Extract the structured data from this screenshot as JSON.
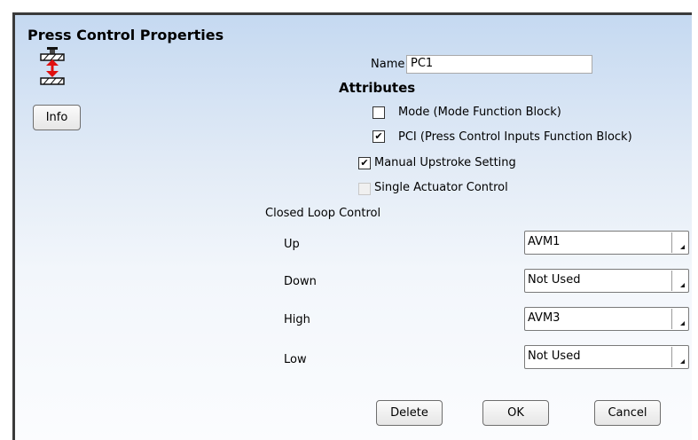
{
  "window": {
    "title": "Press Control Properties"
  },
  "info_button": {
    "label": "Info"
  },
  "name_field": {
    "label": "Name",
    "value": "PC1"
  },
  "attributes": {
    "heading": "Attributes",
    "mode": {
      "label": "Mode (Mode Function Block)",
      "checked": false
    },
    "pci": {
      "label": "PCI (Press Control Inputs Function Block)",
      "checked": true
    },
    "manual_upstroke": {
      "label": "Manual Upstroke Setting",
      "checked": true
    },
    "single_actuator": {
      "label": "Single Actuator Control",
      "checked": false,
      "enabled": false
    }
  },
  "closed_loop": {
    "heading": "Closed Loop Control",
    "rows": [
      {
        "label": "Up",
        "value": "AVM1"
      },
      {
        "label": "Down",
        "value": "Not Used"
      },
      {
        "label": "High",
        "value": "AVM3"
      },
      {
        "label": "Low",
        "value": "Not Used"
      }
    ]
  },
  "buttons": {
    "delete": "Delete",
    "ok": "OK",
    "cancel": "Cancel"
  },
  "colors": {
    "header_gradient_top": "#c5d9f1",
    "press_arrow": "#e01010"
  },
  "icons": {
    "press": "press-control-icon"
  }
}
